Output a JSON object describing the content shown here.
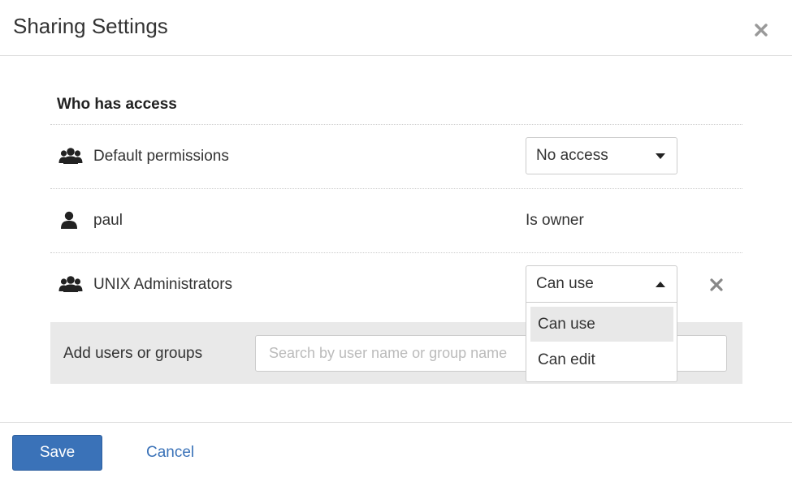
{
  "dialog": {
    "title": "Sharing Settings",
    "close_icon": "close-icon"
  },
  "access": {
    "heading": "Who has access",
    "rows": [
      {
        "icon": "group-icon",
        "name": "Default permissions",
        "permission": "No access",
        "control": "select",
        "caret": "caret-down-icon"
      },
      {
        "icon": "user-icon",
        "name": "paul",
        "permission": "Is owner",
        "control": "text"
      },
      {
        "icon": "group-icon",
        "name": "UNIX Administrators",
        "permission": "Can use",
        "control": "select",
        "caret": "caret-up-icon",
        "removable": true
      }
    ],
    "dropdown": {
      "options": [
        "Can use",
        "Can edit"
      ],
      "highlighted": "Can use"
    }
  },
  "add": {
    "label": "Add users or groups",
    "placeholder": "Search by user name or group name"
  },
  "footer": {
    "save_label": "Save",
    "cancel_label": "Cancel"
  },
  "colors": {
    "primary": "#3a72b8",
    "add_box_bg": "#e9e9e9",
    "highlight": "#e8e8e8"
  }
}
